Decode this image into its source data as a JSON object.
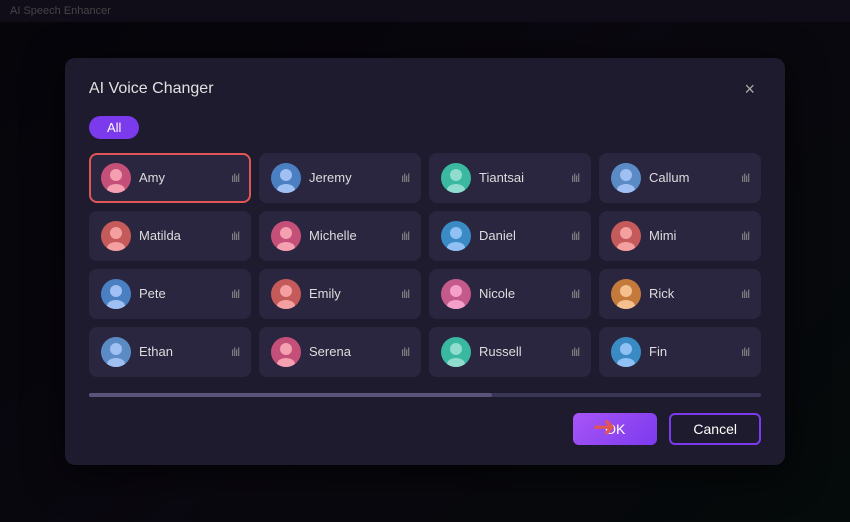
{
  "topbar": {
    "title": "AI Speech Enhancer"
  },
  "modal": {
    "title": "AI Voice Changer",
    "close_label": "×",
    "filter": {
      "all_label": "All"
    },
    "voices": [
      {
        "id": "amy",
        "name": "Amy",
        "avatar_class": "avatar-female-1",
        "selected": true
      },
      {
        "id": "jeremy",
        "name": "Jeremy",
        "avatar_class": "avatar-male-1",
        "selected": false
      },
      {
        "id": "tiantsai",
        "name": "Tiantsai",
        "avatar_class": "avatar-teal",
        "selected": false
      },
      {
        "id": "callum",
        "name": "Callum",
        "avatar_class": "avatar-male-2",
        "selected": false
      },
      {
        "id": "matilda",
        "name": "Matilda",
        "avatar_class": "avatar-female-2",
        "selected": false
      },
      {
        "id": "michelle",
        "name": "Michelle",
        "avatar_class": "avatar-female-1",
        "selected": false
      },
      {
        "id": "daniel",
        "name": "Daniel",
        "avatar_class": "avatar-blue",
        "selected": false
      },
      {
        "id": "mimi",
        "name": "Mimi",
        "avatar_class": "avatar-female-2",
        "selected": false
      },
      {
        "id": "pete",
        "name": "Pete",
        "avatar_class": "avatar-male-1",
        "selected": false
      },
      {
        "id": "emily",
        "name": "Emily",
        "avatar_class": "avatar-female-2",
        "selected": false
      },
      {
        "id": "nicole",
        "name": "Nicole",
        "avatar_class": "avatar-pink",
        "selected": false
      },
      {
        "id": "rick",
        "name": "Rick",
        "avatar_class": "avatar-orange",
        "selected": false
      },
      {
        "id": "ethan",
        "name": "Ethan",
        "avatar_class": "avatar-male-2",
        "selected": false
      },
      {
        "id": "serena",
        "name": "Serena",
        "avatar_class": "avatar-female-1",
        "selected": false
      },
      {
        "id": "russell",
        "name": "Russell",
        "avatar_class": "avatar-teal",
        "selected": false
      },
      {
        "id": "fin",
        "name": "Fin",
        "avatar_class": "avatar-blue",
        "selected": false
      }
    ],
    "footer": {
      "ok_label": "OK",
      "cancel_label": "Cancel"
    }
  },
  "wave_char": "ılıl"
}
